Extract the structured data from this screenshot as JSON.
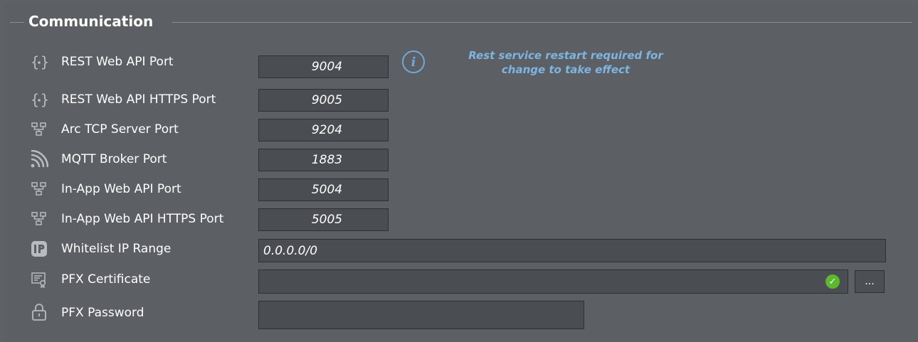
{
  "section": {
    "title": "Communication"
  },
  "info": {
    "message_line1": "Rest service restart required for",
    "message_line2": "change to take effect",
    "icon": "info-icon"
  },
  "rows": [
    {
      "label": "REST Web API Port",
      "value": "9004",
      "icon": "braces-icon"
    },
    {
      "label": "REST Web API HTTPS Port",
      "value": "9005",
      "icon": "braces-icon"
    },
    {
      "label": "Arc TCP Server Port",
      "value": "9204",
      "icon": "network-icon"
    },
    {
      "label": "MQTT Broker Port",
      "value": "1883",
      "icon": "broadcast-icon"
    },
    {
      "label": "In-App Web API Port",
      "value": "5004",
      "icon": "network-icon"
    },
    {
      "label": "In-App Web API HTTPS Port",
      "value": "5005",
      "icon": "network-icon"
    },
    {
      "label": "Whitelist IP Range",
      "value": "0.0.0.0/0",
      "icon": "ip-icon"
    },
    {
      "label": "PFX Certificate",
      "value": "",
      "icon": "certificate-icon"
    },
    {
      "label": "PFX Password",
      "value": "",
      "icon": "lock-icon"
    }
  ],
  "browse_button": {
    "label": "..."
  },
  "colors": {
    "accent": "#7eb4e0",
    "valid": "#5cb82e",
    "background": "#5c6064"
  }
}
